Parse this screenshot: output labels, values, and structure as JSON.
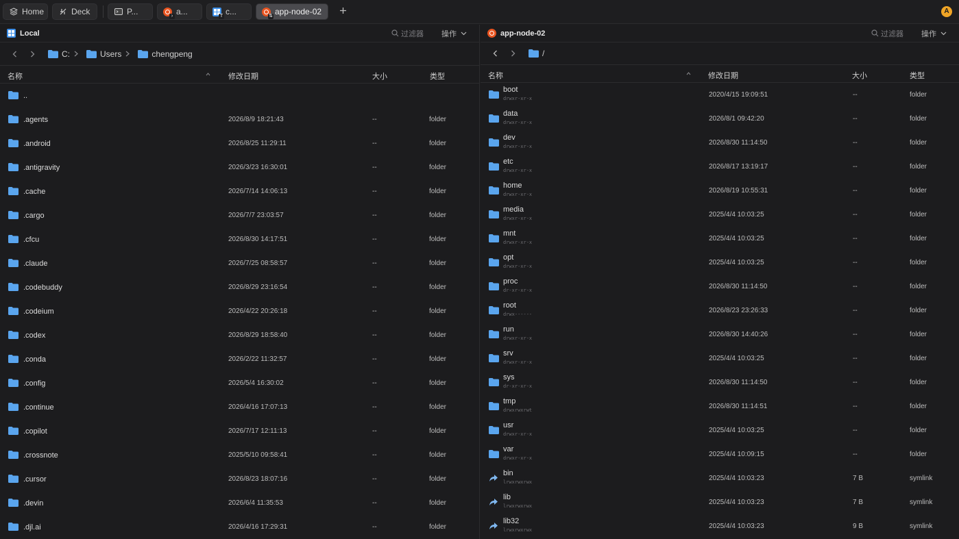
{
  "tabs": [
    {
      "label": "Home",
      "icon": "stack-icon"
    },
    {
      "label": "Deck",
      "icon": "deck-icon"
    },
    {
      "label": "P...",
      "icon": "terminal-icon"
    },
    {
      "label": "a...",
      "icon": "ubuntu-icon"
    },
    {
      "label": "c...",
      "icon": "windows-icon"
    },
    {
      "label": "app-node-02",
      "icon": "ubuntu-icon",
      "active": true
    }
  ],
  "avatar_letter": "A",
  "left": {
    "title": "Local",
    "filter_placeholder": "过滤器",
    "ops_label": "操作",
    "crumbs": [
      "C:",
      "Users",
      "chengpeng"
    ],
    "columns": {
      "name": "名称",
      "date": "修改日期",
      "size": "大小",
      "type": "类型"
    },
    "rows": [
      {
        "name": "..",
        "date": "",
        "size": "",
        "type": ""
      },
      {
        "name": ".agents",
        "date": "2026/8/9 18:21:43",
        "size": "--",
        "type": "folder"
      },
      {
        "name": ".android",
        "date": "2026/8/25 11:29:11",
        "size": "--",
        "type": "folder"
      },
      {
        "name": ".antigravity",
        "date": "2026/3/23 16:30:01",
        "size": "--",
        "type": "folder"
      },
      {
        "name": ".cache",
        "date": "2026/7/14 14:06:13",
        "size": "--",
        "type": "folder"
      },
      {
        "name": ".cargo",
        "date": "2026/7/7 23:03:57",
        "size": "--",
        "type": "folder"
      },
      {
        "name": ".cfcu",
        "date": "2026/8/30 14:17:51",
        "size": "--",
        "type": "folder"
      },
      {
        "name": ".claude",
        "date": "2026/7/25 08:58:57",
        "size": "--",
        "type": "folder"
      },
      {
        "name": ".codebuddy",
        "date": "2026/8/29 23:16:54",
        "size": "--",
        "type": "folder"
      },
      {
        "name": ".codeium",
        "date": "2026/4/22 20:26:18",
        "size": "--",
        "type": "folder"
      },
      {
        "name": ".codex",
        "date": "2026/8/29 18:58:40",
        "size": "--",
        "type": "folder"
      },
      {
        "name": ".conda",
        "date": "2026/2/22 11:32:57",
        "size": "--",
        "type": "folder"
      },
      {
        "name": ".config",
        "date": "2026/5/4 16:30:02",
        "size": "--",
        "type": "folder"
      },
      {
        "name": ".continue",
        "date": "2026/4/16 17:07:13",
        "size": "--",
        "type": "folder"
      },
      {
        "name": ".copilot",
        "date": "2026/7/17 12:11:13",
        "size": "--",
        "type": "folder"
      },
      {
        "name": ".crossnote",
        "date": "2025/5/10 09:58:41",
        "size": "--",
        "type": "folder"
      },
      {
        "name": ".cursor",
        "date": "2026/8/23 18:07:16",
        "size": "--",
        "type": "folder"
      },
      {
        "name": ".devin",
        "date": "2026/6/4 11:35:53",
        "size": "--",
        "type": "folder"
      },
      {
        "name": ".djl.ai",
        "date": "2026/4/16 17:29:31",
        "size": "--",
        "type": "folder"
      }
    ]
  },
  "right": {
    "title": "app-node-02",
    "filter_placeholder": "过滤器",
    "ops_label": "操作",
    "crumbs": [
      "/"
    ],
    "columns": {
      "name": "名称",
      "date": "修改日期",
      "size": "大小",
      "type": "类型"
    },
    "rows": [
      {
        "name": "boot",
        "perm": "drwxr-xr-x",
        "date": "2020/4/15 19:09:51",
        "size": "--",
        "type": "folder"
      },
      {
        "name": "data",
        "perm": "drwxr-xr-x",
        "date": "2026/8/1 09:42:20",
        "size": "--",
        "type": "folder"
      },
      {
        "name": "dev",
        "perm": "drwxr-xr-x",
        "date": "2026/8/30 11:14:50",
        "size": "--",
        "type": "folder"
      },
      {
        "name": "etc",
        "perm": "drwxr-xr-x",
        "date": "2026/8/17 13:19:17",
        "size": "--",
        "type": "folder"
      },
      {
        "name": "home",
        "perm": "drwxr-xr-x",
        "date": "2026/8/19 10:55:31",
        "size": "--",
        "type": "folder"
      },
      {
        "name": "media",
        "perm": "drwxr-xr-x",
        "date": "2025/4/4 10:03:25",
        "size": "--",
        "type": "folder"
      },
      {
        "name": "mnt",
        "perm": "drwxr-xr-x",
        "date": "2025/4/4 10:03:25",
        "size": "--",
        "type": "folder"
      },
      {
        "name": "opt",
        "perm": "drwxr-xr-x",
        "date": "2025/4/4 10:03:25",
        "size": "--",
        "type": "folder"
      },
      {
        "name": "proc",
        "perm": "dr-xr-xr-x",
        "date": "2026/8/30 11:14:50",
        "size": "--",
        "type": "folder"
      },
      {
        "name": "root",
        "perm": "drwx------",
        "date": "2026/8/23 23:26:33",
        "size": "--",
        "type": "folder"
      },
      {
        "name": "run",
        "perm": "drwxr-xr-x",
        "date": "2026/8/30 14:40:26",
        "size": "--",
        "type": "folder"
      },
      {
        "name": "srv",
        "perm": "drwxr-xr-x",
        "date": "2025/4/4 10:03:25",
        "size": "--",
        "type": "folder"
      },
      {
        "name": "sys",
        "perm": "dr-xr-xr-x",
        "date": "2026/8/30 11:14:50",
        "size": "--",
        "type": "folder"
      },
      {
        "name": "tmp",
        "perm": "drwxrwxrwt",
        "date": "2026/8/30 11:14:51",
        "size": "--",
        "type": "folder"
      },
      {
        "name": "usr",
        "perm": "drwxr-xr-x",
        "date": "2025/4/4 10:03:25",
        "size": "--",
        "type": "folder"
      },
      {
        "name": "var",
        "perm": "drwxr-xr-x",
        "date": "2025/4/4 10:09:15",
        "size": "--",
        "type": "folder"
      },
      {
        "name": "bin",
        "perm": "lrwxrwxrwx",
        "date": "2025/4/4 10:03:23",
        "size": "7 B",
        "type": "symlink"
      },
      {
        "name": "lib",
        "perm": "lrwxrwxrwx",
        "date": "2025/4/4 10:03:23",
        "size": "7 B",
        "type": "symlink"
      },
      {
        "name": "lib32",
        "perm": "lrwxrwxrwx",
        "date": "2025/4/4 10:03:23",
        "size": "9 B",
        "type": "symlink"
      }
    ]
  },
  "colors": {
    "folder": "#5aa5ee",
    "accent": "#f0a526",
    "ubuntu": "#e95420",
    "windows": "#3b8ee8"
  }
}
